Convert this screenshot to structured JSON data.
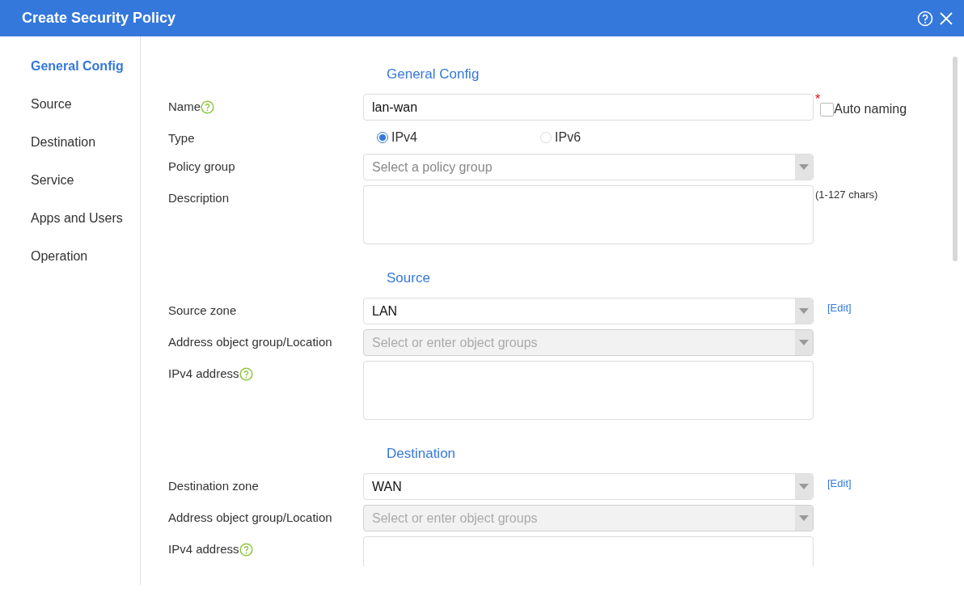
{
  "window": {
    "title": "Create Security Policy"
  },
  "sidebar": {
    "items": [
      {
        "label": "General Config",
        "selected": true
      },
      {
        "label": "Source",
        "selected": false
      },
      {
        "label": "Destination",
        "selected": false
      },
      {
        "label": "Service",
        "selected": false
      },
      {
        "label": "Apps and Users",
        "selected": false
      },
      {
        "label": "Operation",
        "selected": false
      }
    ]
  },
  "sections": [
    {
      "title": "General Config",
      "rows": [
        {
          "kind": "text",
          "label": "Name",
          "help": true,
          "value": "lan-wan",
          "required_marker": "*",
          "checkbox": {
            "label": "Auto naming",
            "checked": false
          }
        },
        {
          "kind": "radio",
          "label": "Type",
          "help": false,
          "options": [
            {
              "label": "IPv4",
              "selected": true
            },
            {
              "label": "IPv6",
              "selected": false
            }
          ]
        },
        {
          "kind": "select",
          "label": "Policy group",
          "help": false,
          "placeholder": "Select a policy group",
          "disabled": false
        },
        {
          "kind": "textarea",
          "label": "Description",
          "help": false,
          "note": "(1-127 chars)"
        }
      ]
    },
    {
      "title": "Source",
      "rows": [
        {
          "kind": "select",
          "label": "Source zone",
          "help": false,
          "value": "LAN",
          "disabled": false,
          "link": "[Edit]"
        },
        {
          "kind": "select",
          "label": "Address object group/Location",
          "help": false,
          "placeholder": "Select or enter object groups",
          "disabled": true
        },
        {
          "kind": "textarea",
          "label": "IPv4 address",
          "help": true
        }
      ]
    },
    {
      "title": "Destination",
      "rows": [
        {
          "kind": "select",
          "label": "Destination zone",
          "help": false,
          "value": "WAN",
          "disabled": false,
          "link": "[Edit]"
        },
        {
          "kind": "select",
          "label": "Address object group/Location",
          "help": false,
          "placeholder": "Select or enter object groups",
          "disabled": true
        },
        {
          "kind": "textarea",
          "label": "IPv4 address",
          "help": true
        }
      ]
    }
  ]
}
